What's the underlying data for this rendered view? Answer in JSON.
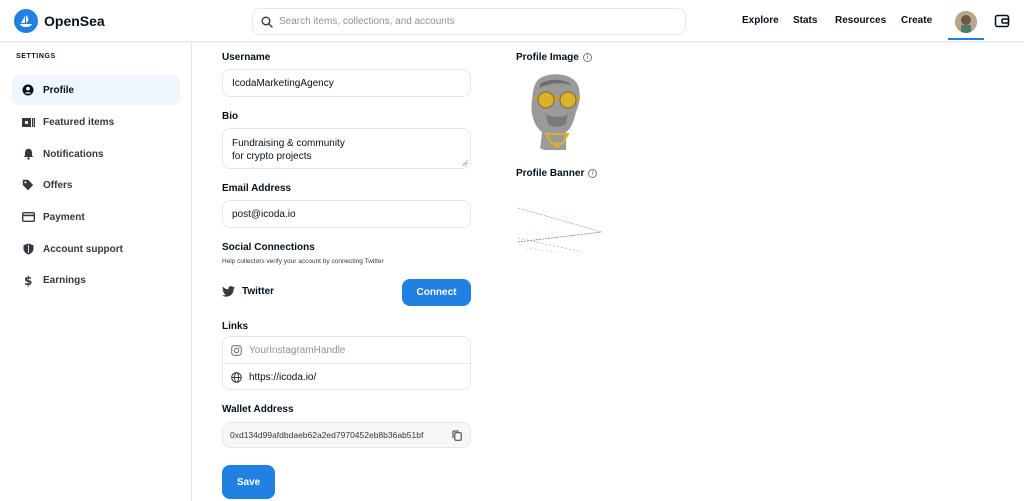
{
  "app": {
    "name": "OpenSea"
  },
  "search": {
    "placeholder": "Search items, collections, and accounts"
  },
  "nav": {
    "explore": "Explore",
    "stats": "Stats",
    "resources": "Resources",
    "create": "Create"
  },
  "sidebar": {
    "heading": "SETTINGS",
    "items": [
      {
        "label": "Profile",
        "icon": "user-circle-icon",
        "active": true
      },
      {
        "label": "Featured items",
        "icon": "featured-items-icon",
        "active": false
      },
      {
        "label": "Notifications",
        "icon": "bell-icon",
        "active": false
      },
      {
        "label": "Offers",
        "icon": "tag-icon",
        "active": false
      },
      {
        "label": "Payment",
        "icon": "credit-card-icon",
        "active": false
      },
      {
        "label": "Account support",
        "icon": "shield-icon",
        "active": false
      },
      {
        "label": "Earnings",
        "icon": "dollar-icon",
        "active": false
      }
    ]
  },
  "form": {
    "username_label": "Username",
    "username_value": "IcodaMarketingAgency",
    "bio_label": "Bio",
    "bio_value": "Fundraising & community\nfor crypto projects",
    "email_label": "Email Address",
    "email_value": "post@icoda.io",
    "social_label": "Social Connections",
    "social_hint": "Help collectors verify your account by connecting Twitter",
    "twitter_label": "Twitter",
    "connect_label": "Connect",
    "links_label": "Links",
    "instagram_placeholder": "YourInstagramHandle",
    "website_value": "https://icoda.io/",
    "wallet_label": "Wallet Address",
    "wallet_value": "0xd134d99afdbdaeb62a2ed7970452eb8b36ab51bf",
    "save_label": "Save"
  },
  "right": {
    "profile_image_label": "Profile Image",
    "profile_banner_label": "Profile Banner"
  },
  "colors": {
    "accent": "#2081e2",
    "text": "#04111d",
    "border": "#e5e8eb",
    "active_bg": "#f0f6fd"
  }
}
